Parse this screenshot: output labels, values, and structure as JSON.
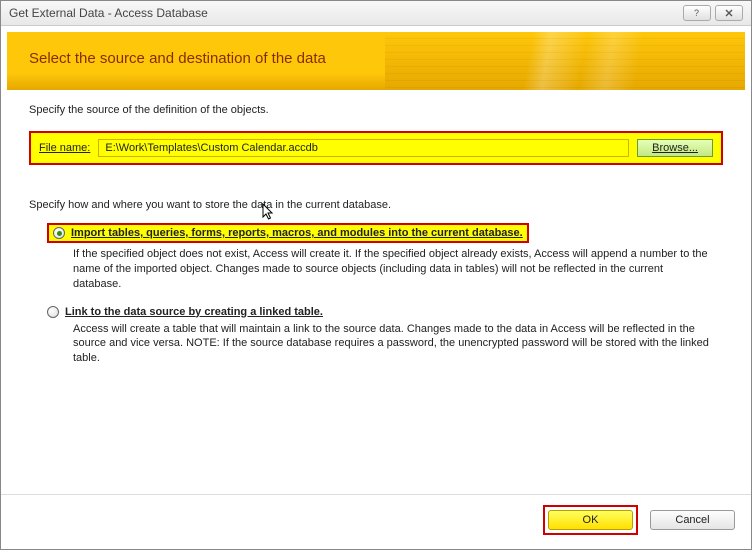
{
  "window": {
    "title": "Get External Data - Access Database"
  },
  "header": {
    "title": "Select the source and destination of the data"
  },
  "source": {
    "intro": "Specify the source of the definition of the objects.",
    "file_label": "File name:",
    "file_path": "E:\\Work\\Templates\\Custom Calendar.accdb",
    "browse_label": "Browse..."
  },
  "how": {
    "intro": "Specify how and where you want to store the data in the current database."
  },
  "options": {
    "import": {
      "label": "Import tables, queries, forms, reports, macros, and modules into the current database.",
      "desc": "If the specified object does not exist, Access will create it. If the specified object already exists, Access will append a number to the name of the imported object. Changes made to source objects (including data in tables) will not be reflected in the current database.",
      "checked": true
    },
    "link": {
      "label": "Link to the data source by creating a linked table.",
      "desc": "Access will create a table that will maintain a link to the source data. Changes made to the data in Access will be reflected in the source and vice versa. NOTE:  If the source database requires a password, the unencrypted password will be stored with the linked table.",
      "checked": false
    }
  },
  "buttons": {
    "ok": "OK",
    "cancel": "Cancel"
  }
}
